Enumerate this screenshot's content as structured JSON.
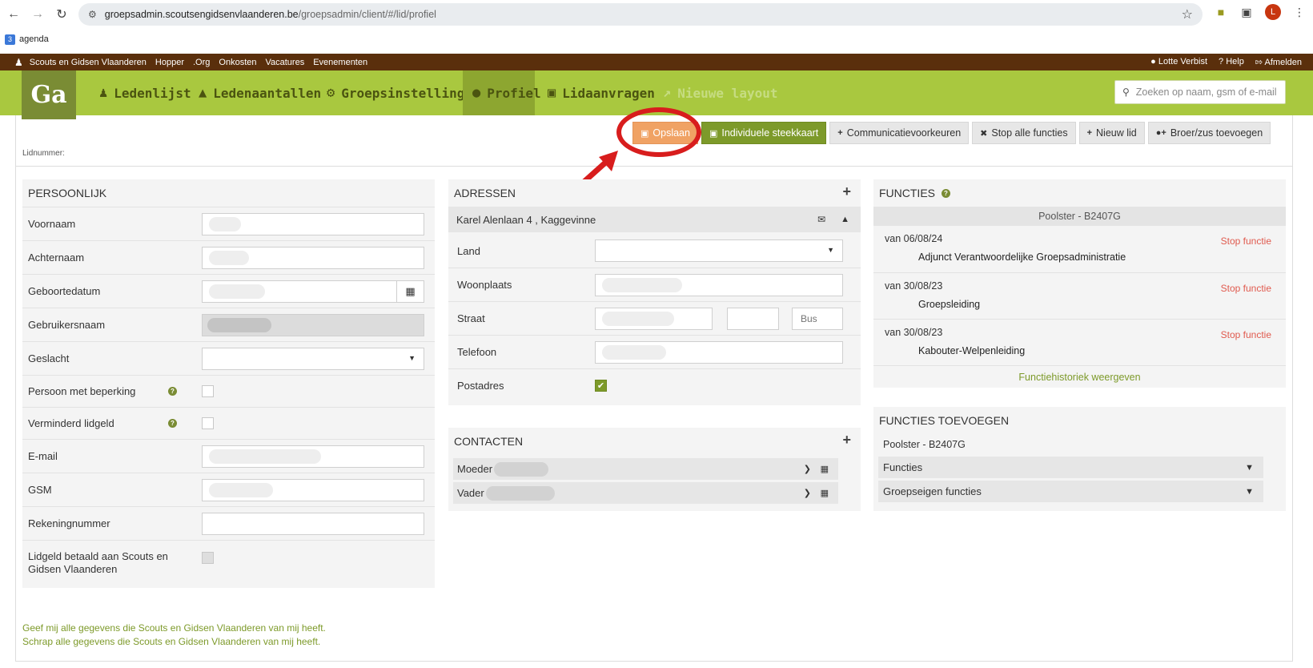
{
  "browser": {
    "url_host": "groepsadmin.scoutsengidsenvlaanderen.be",
    "url_path": "/groepsadmin/client/#/lid/profiel",
    "avatar_letter": "L",
    "bookmark": "agenda"
  },
  "topbar": {
    "links": [
      "Scouts en Gidsen Vlaanderen",
      "Hopper",
      ".Org",
      "Onkosten",
      "Vacatures",
      "Evenementen"
    ],
    "user": "Lotte Verbist",
    "help": "Help",
    "logout": "Afmelden"
  },
  "nav": {
    "logo": "Ga",
    "items": [
      "Ledenlijst",
      "Ledenaantallen",
      "Groepsinstellingen",
      "Profiel",
      "Lidaanvragen",
      "Nieuwe layout"
    ],
    "search_placeholder": "Zoeken op naam, gsm of e-mail"
  },
  "header": {
    "lidnummer_label": "Lidnummer:"
  },
  "actions": {
    "save": "Opslaan",
    "card": "Individuele steekkaart",
    "communication": "Communicatievoorkeuren",
    "stop_all": "Stop alle functies",
    "new_member": "Nieuw lid",
    "add_sibling": "Broer/zus toevoegen"
  },
  "personal": {
    "title": "PERSOONLIJK",
    "labels": {
      "voornaam": "Voornaam",
      "achternaam": "Achternaam",
      "geboortedatum": "Geboortedatum",
      "gebruikersnaam": "Gebruikersnaam",
      "geslacht": "Geslacht",
      "beperking": "Persoon met beperking",
      "verminderd": "Verminderd lidgeld",
      "email": "E-mail",
      "gsm": "GSM",
      "rekeningnummer": "Rekeningnummer",
      "lidgeld": "Lidgeld betaald aan Scouts en Gidsen Vlaanderen"
    }
  },
  "addresses": {
    "title": "ADRESSEN",
    "address_line": "Karel Alenlaan 4 , Kaggevinne",
    "labels": {
      "land": "Land",
      "woonplaats": "Woonplaats",
      "straat": "Straat",
      "telefoon": "Telefoon",
      "postadres": "Postadres"
    },
    "bus_placeholder": "Bus"
  },
  "contacts": {
    "title": "CONTACTEN",
    "items": [
      "Moeder",
      "Vader"
    ]
  },
  "functions": {
    "title": "FUNCTIES",
    "group": "Poolster - B2407G",
    "items": [
      {
        "since": "van 06/08/24",
        "name": "Adjunct Verantwoordelijke Groepsadministratie",
        "stop": "Stop functie"
      },
      {
        "since": "van 30/08/23",
        "name": "Groepsleiding",
        "stop": "Stop functie"
      },
      {
        "since": "van 30/08/23",
        "name": "Kabouter-Welpenleiding",
        "stop": "Stop functie"
      }
    ],
    "history": "Functiehistoriek weergeven"
  },
  "add_functions": {
    "title": "FUNCTIES TOEVOEGEN",
    "group": "Poolster - B2407G",
    "functions": "Functies",
    "group_functions": "Groepseigen functies"
  },
  "footer": {
    "give_data": "Geef mij alle gegevens die Scouts en Gidsen Vlaanderen van mij heeft.",
    "delete_data": "Schrap alle gegevens die Scouts en Gidsen Vlaanderen van mij heeft."
  },
  "colors": {
    "nav_green": "#a9c83f",
    "topbar_brown": "#5a2f0c",
    "save_orange": "#f0a264",
    "card_green": "#7d9a2a",
    "annotation_red": "#d81d1d"
  }
}
